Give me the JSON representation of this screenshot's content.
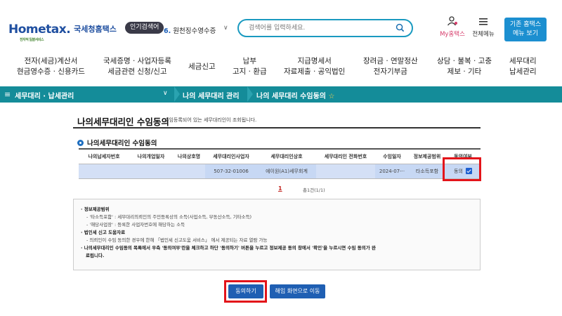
{
  "header": {
    "logo_text": "Hometax.",
    "logo_tagline": "전자적 일괄서비스",
    "site_name": "국세청홈택스",
    "popular_badge": "인기검색어",
    "popular_rank": "6.",
    "popular_term": "원천징수영수증",
    "search_placeholder": "검색어를 입력하세요.",
    "my_hometax": "My홈택스",
    "all_menu": "전체메뉴",
    "legacy_line1": "기존 홈택스",
    "legacy_line2": "메뉴 보기"
  },
  "main_menu": [
    {
      "line1": "전자(세금)계산서",
      "line2": "현금영수증 · 신용카드"
    },
    {
      "line1": "국세증명 · 사업자등록",
      "line2": "세금관련 신청/신고"
    },
    {
      "line1": "세금신고",
      "line2": ""
    },
    {
      "line1": "납부",
      "line2": "고지 · 환급"
    },
    {
      "line1": "지급명세서",
      "line2": "자료제출 · 공익법인"
    },
    {
      "line1": "장려금 · 연말정산",
      "line2": "전자기부금"
    },
    {
      "line1": "상담 · 불복 · 고충",
      "line2": "제보 · 기타"
    },
    {
      "line1": "세무대리",
      "line2": "납세관리"
    }
  ],
  "nav": {
    "section": "세무대리 · 납세관리",
    "crumb1": "나의 세무대리 관리",
    "crumb2": "나의 세무대리 수임동의",
    "star": "☆"
  },
  "page": {
    "title": "나의세무대리인 수임동의",
    "description": "수임등록되어 있는 세무대리인이 조회됩니다.",
    "section_title": "나의세무대리인 수임동의"
  },
  "table": {
    "headers": [
      "나의납세자번호",
      "나의개업일자",
      "나의상호명",
      "세무대리인사업자",
      "세무대리인상호",
      "세무대리인 전화번호",
      "수임일자",
      "정보제공범위",
      "동의여부"
    ],
    "rows": [
      {
        "taxpayer_no": "",
        "open_date": "",
        "company": "",
        "agent_bizno": "507-32-01006",
        "agent_name": "에이원(A1)세무회계",
        "agent_phone": "",
        "date": "2024-07-··",
        "scope": "타소득포함",
        "consent": "동의"
      }
    ]
  },
  "pager": {
    "current": "1",
    "total": "총1건(1/1)"
  },
  "info": {
    "h1": "· 정보제공범위",
    "l1": "- '타소득포함' : 세무대리의뢰인의 주민등록상의 소득(사업소득, 부동산소득, 기타소득)",
    "l2": "- '해당사업장' : 등록한 사업자번호에 해당하는 소득",
    "h2": "· 법인세 신고 도움자료",
    "l3": "- 의뢰인이 수임 동의한 경우에 한해 「법인세 신고도움 서비스」 에서 제공되는 자료 열람 가능",
    "warn1": "· 나의세무대리인 수임동의 목록에서 우측 '동의여부'란을 체크하고 하단 '동의하기' 버튼을 누르고 정보제공 동의 창에서 '확인'을 누르시면 수임 동의가 완",
    "warn2": "료됩니다."
  },
  "buttons": {
    "agree": "동의하기",
    "move": "해임 화면으로 이동"
  },
  "colors": {
    "nav_teal": "#148c99",
    "primary_blue": "#1f5fb3",
    "highlight_red": "#e3141a",
    "selected_row": "#c7d8f4"
  }
}
